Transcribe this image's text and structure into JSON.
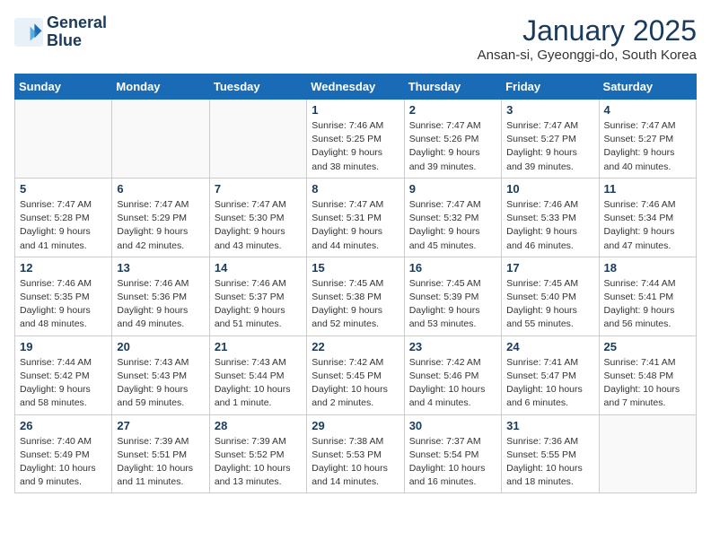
{
  "header": {
    "logo_line1": "General",
    "logo_line2": "Blue",
    "title": "January 2025",
    "subtitle": "Ansan-si, Gyeonggi-do, South Korea"
  },
  "days_of_week": [
    "Sunday",
    "Monday",
    "Tuesday",
    "Wednesday",
    "Thursday",
    "Friday",
    "Saturday"
  ],
  "weeks": [
    [
      {
        "day": "",
        "info": ""
      },
      {
        "day": "",
        "info": ""
      },
      {
        "day": "",
        "info": ""
      },
      {
        "day": "1",
        "info": "Sunrise: 7:46 AM\nSunset: 5:25 PM\nDaylight: 9 hours and 38 minutes."
      },
      {
        "day": "2",
        "info": "Sunrise: 7:47 AM\nSunset: 5:26 PM\nDaylight: 9 hours and 39 minutes."
      },
      {
        "day": "3",
        "info": "Sunrise: 7:47 AM\nSunset: 5:27 PM\nDaylight: 9 hours and 39 minutes."
      },
      {
        "day": "4",
        "info": "Sunrise: 7:47 AM\nSunset: 5:27 PM\nDaylight: 9 hours and 40 minutes."
      }
    ],
    [
      {
        "day": "5",
        "info": "Sunrise: 7:47 AM\nSunset: 5:28 PM\nDaylight: 9 hours and 41 minutes."
      },
      {
        "day": "6",
        "info": "Sunrise: 7:47 AM\nSunset: 5:29 PM\nDaylight: 9 hours and 42 minutes."
      },
      {
        "day": "7",
        "info": "Sunrise: 7:47 AM\nSunset: 5:30 PM\nDaylight: 9 hours and 43 minutes."
      },
      {
        "day": "8",
        "info": "Sunrise: 7:47 AM\nSunset: 5:31 PM\nDaylight: 9 hours and 44 minutes."
      },
      {
        "day": "9",
        "info": "Sunrise: 7:47 AM\nSunset: 5:32 PM\nDaylight: 9 hours and 45 minutes."
      },
      {
        "day": "10",
        "info": "Sunrise: 7:46 AM\nSunset: 5:33 PM\nDaylight: 9 hours and 46 minutes."
      },
      {
        "day": "11",
        "info": "Sunrise: 7:46 AM\nSunset: 5:34 PM\nDaylight: 9 hours and 47 minutes."
      }
    ],
    [
      {
        "day": "12",
        "info": "Sunrise: 7:46 AM\nSunset: 5:35 PM\nDaylight: 9 hours and 48 minutes."
      },
      {
        "day": "13",
        "info": "Sunrise: 7:46 AM\nSunset: 5:36 PM\nDaylight: 9 hours and 49 minutes."
      },
      {
        "day": "14",
        "info": "Sunrise: 7:46 AM\nSunset: 5:37 PM\nDaylight: 9 hours and 51 minutes."
      },
      {
        "day": "15",
        "info": "Sunrise: 7:45 AM\nSunset: 5:38 PM\nDaylight: 9 hours and 52 minutes."
      },
      {
        "day": "16",
        "info": "Sunrise: 7:45 AM\nSunset: 5:39 PM\nDaylight: 9 hours and 53 minutes."
      },
      {
        "day": "17",
        "info": "Sunrise: 7:45 AM\nSunset: 5:40 PM\nDaylight: 9 hours and 55 minutes."
      },
      {
        "day": "18",
        "info": "Sunrise: 7:44 AM\nSunset: 5:41 PM\nDaylight: 9 hours and 56 minutes."
      }
    ],
    [
      {
        "day": "19",
        "info": "Sunrise: 7:44 AM\nSunset: 5:42 PM\nDaylight: 9 hours and 58 minutes."
      },
      {
        "day": "20",
        "info": "Sunrise: 7:43 AM\nSunset: 5:43 PM\nDaylight: 9 hours and 59 minutes."
      },
      {
        "day": "21",
        "info": "Sunrise: 7:43 AM\nSunset: 5:44 PM\nDaylight: 10 hours and 1 minute."
      },
      {
        "day": "22",
        "info": "Sunrise: 7:42 AM\nSunset: 5:45 PM\nDaylight: 10 hours and 2 minutes."
      },
      {
        "day": "23",
        "info": "Sunrise: 7:42 AM\nSunset: 5:46 PM\nDaylight: 10 hours and 4 minutes."
      },
      {
        "day": "24",
        "info": "Sunrise: 7:41 AM\nSunset: 5:47 PM\nDaylight: 10 hours and 6 minutes."
      },
      {
        "day": "25",
        "info": "Sunrise: 7:41 AM\nSunset: 5:48 PM\nDaylight: 10 hours and 7 minutes."
      }
    ],
    [
      {
        "day": "26",
        "info": "Sunrise: 7:40 AM\nSunset: 5:49 PM\nDaylight: 10 hours and 9 minutes."
      },
      {
        "day": "27",
        "info": "Sunrise: 7:39 AM\nSunset: 5:51 PM\nDaylight: 10 hours and 11 minutes."
      },
      {
        "day": "28",
        "info": "Sunrise: 7:39 AM\nSunset: 5:52 PM\nDaylight: 10 hours and 13 minutes."
      },
      {
        "day": "29",
        "info": "Sunrise: 7:38 AM\nSunset: 5:53 PM\nDaylight: 10 hours and 14 minutes."
      },
      {
        "day": "30",
        "info": "Sunrise: 7:37 AM\nSunset: 5:54 PM\nDaylight: 10 hours and 16 minutes."
      },
      {
        "day": "31",
        "info": "Sunrise: 7:36 AM\nSunset: 5:55 PM\nDaylight: 10 hours and 18 minutes."
      },
      {
        "day": "",
        "info": ""
      }
    ]
  ]
}
